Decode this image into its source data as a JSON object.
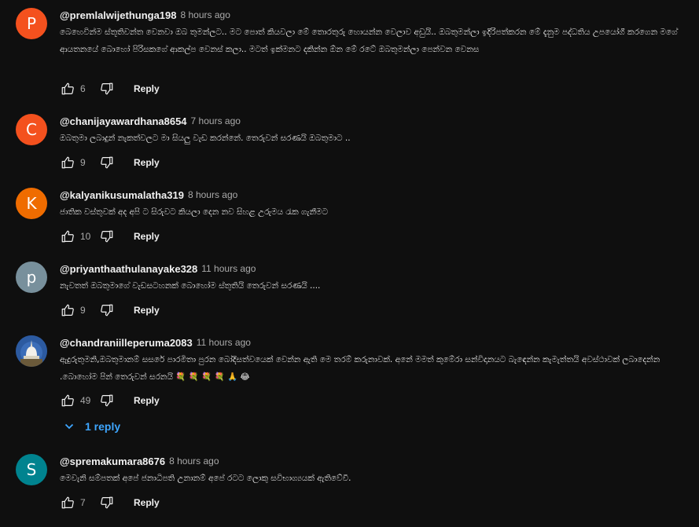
{
  "colors": {
    "background": "#0f0f0f",
    "text": "#f1f1f1",
    "secondary_text": "#aaaaaa",
    "link": "#3ea6ff"
  },
  "comments": [
    {
      "author": "@premlalwijethunga198",
      "time": "8 hours ago",
      "avatar_letter": "P",
      "avatar_color": "#f4511e",
      "text": "බෙහෙවින්ම ස්තූතිවන්ත වෙනවා ඔබ තුමන්ලට.. මට පොත් කියවලා මේ තොරතුරු හොයන්න වෙලාව අඩුයි.. ඔබතුමන්ලා ඉදිරිපත්කරන මේ දැනුම පද්ධතිය උපයෝගී කරගෙන මගේ ආයතනයේ බොහෝ පිරිසකගේ ආකල්ප වෙනස් කලා.. මටත් ඉක්මනට දකින්න ඕන මේ රටේ ඔබතුමන්ලා පෙන්වන වෙනස",
      "likes": "6",
      "reply_label": "Reply"
    },
    {
      "author": "@chanijayawardhana8654",
      "time": "7 hours ago",
      "avatar_letter": "C",
      "avatar_color": "#f4511e",
      "text": "ඔබතුමා ලබාදුන් නැකත්වලට මා සියලු වැඩ කරන්නේ. තෙරුවන් සරණයි ඔබතුමාට ..",
      "likes": "9",
      "reply_label": "Reply"
    },
    {
      "author": "@kalyanikusumalatha319",
      "time": "8 hours ago",
      "avatar_letter": "K",
      "avatar_color": "#ef6c00",
      "text": "ජාතික වස්තුවක් අද අපි ට සිරුවට කියලා දෙන නව සිහළ උරුමය රැක ගැනීමට",
      "likes": "10",
      "reply_label": "Reply"
    },
    {
      "author": "@priyanthaathulanayake328",
      "time": "11 hours ago",
      "avatar_letter": "p",
      "avatar_color": "#78909c",
      "text": "නැවතත් ඔබතුමාගේ වැඩසටහනක් බොහෝම ස්තුතියි තෙරුවන් සරණයි ....",
      "likes": "9",
      "reply_label": "Reply"
    },
    {
      "author": "@chandraniilleperuma2083",
      "time": "11 hours ago",
      "avatar_letter": "",
      "avatar_color": "#1d3a6b",
      "text": "ඇදුරුතුමනි,ඔබතුමානම් සසරේ පාරමිතා පුරන බෝදිසත්වයෙක් වෙන්න ඇති මෙ තරම් කරුනාවක්. අනේ මමත් කුමේරා සන්විදානයට බැඳෙන්න කැමැත්තයි අවස්ථාවක් ලබාදෙන්න .බොහෝම පින් තෙරුවන් සරනයි 💐 💐 💐 💐 🙏 😂",
      "likes": "49",
      "reply_label": "Reply",
      "replies_label": "1 reply"
    },
    {
      "author": "@spremakumara8676",
      "time": "8 hours ago",
      "avatar_letter": "S",
      "avatar_color": "#00838f",
      "text": "මෙවැනි සම්පතක් අපේ ජනාධිපති උනානම් අපේ රටට ලොකු සවිභාග්‍යයක් ඇතිවේවී.",
      "likes": "7",
      "reply_label": "Reply"
    }
  ]
}
